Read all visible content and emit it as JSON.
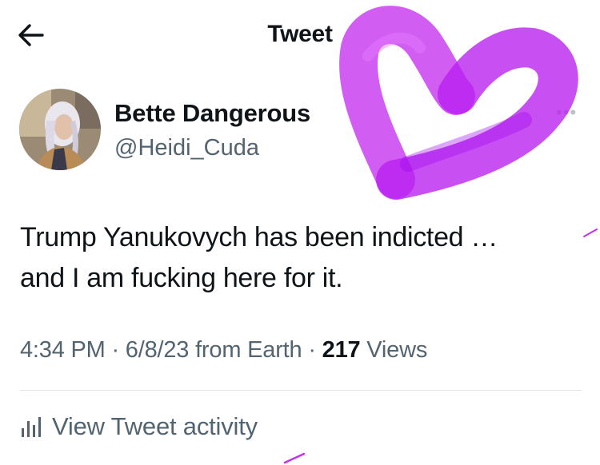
{
  "header": {
    "title": "Tweet",
    "back_icon": "arrow-left-icon"
  },
  "tweet": {
    "author_name": "Bette Dangerous",
    "author_handle": "@Heidi_Cuda",
    "more_icon": "more-horizontal-icon",
    "text_line1": "Trump Yanukovych has been indicted …",
    "text_line2": "and I am fucking here for it.",
    "time": "4:34 PM",
    "separator": " · ",
    "date": "6/8/23",
    "source_prefix": " from ",
    "source": "Earth",
    "views_count": "217",
    "views_label": " Views"
  },
  "activity": {
    "label": "View Tweet activity",
    "icon": "analytics-bars-icon"
  },
  "colors": {
    "text_primary": "#0f1419",
    "text_secondary": "#536471",
    "divider": "#dfe4e7",
    "heart_marker": "#bf1ff0"
  }
}
